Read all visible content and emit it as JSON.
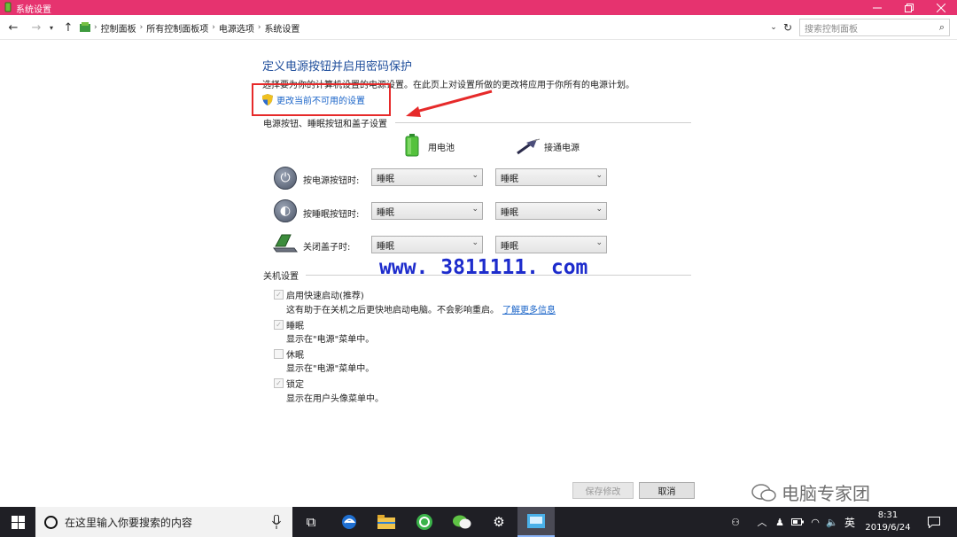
{
  "window": {
    "title": "系统设置",
    "controls": [
      "minimize",
      "maximize",
      "close"
    ]
  },
  "address": {
    "breadcrumbs": [
      "控制面板",
      "所有控制面板项",
      "电源选项",
      "系统设置"
    ],
    "search_placeholder": "搜索控制面板"
  },
  "page": {
    "heading": "定义电源按钮并启用密码保护",
    "description": "选择要为你的计算机设置的电源设置。在此页上对设置所做的更改将应用于你所有的电源计划。",
    "change_link": "更改当前不可用的设置",
    "power_section_title": "电源按钮、睡眠按钮和盖子设置",
    "columns": {
      "battery": "用电池",
      "plugged": "接通电源"
    },
    "rows": [
      {
        "label": "按电源按钮时:",
        "battery": "睡眠",
        "plugged": "睡眠",
        "icon": "power-icon"
      },
      {
        "label": "按睡眠按钮时:",
        "battery": "睡眠",
        "plugged": "睡眠",
        "icon": "sleep-icon"
      },
      {
        "label": "关闭盖子时:",
        "battery": "睡眠",
        "plugged": "睡眠",
        "icon": "laptop-lid-icon"
      }
    ],
    "shutdown_section_title": "关机设置",
    "shutdown_options": [
      {
        "label": "启用快速启动(推荐)",
        "desc": "这有助于在关机之后更快地启动电脑。不会影响重启。",
        "link": "了解更多信息",
        "checked": true
      },
      {
        "label": "睡眠",
        "desc": "显示在\"电源\"菜单中。",
        "checked": true
      },
      {
        "label": "休眠",
        "desc": "显示在\"电源\"菜单中。",
        "checked": false
      },
      {
        "label": "锁定",
        "desc": "显示在用户头像菜单中。",
        "checked": true
      }
    ],
    "watermark": "www. 3811111. com",
    "save_button": "保存修改",
    "cancel_button": "取消"
  },
  "overlay_brand": "电脑专家团",
  "taskbar": {
    "search_placeholder": "在这里输入你要搜索的内容",
    "input_indicator": "英",
    "time": "8:31",
    "date": "2019/6/24"
  },
  "colors": {
    "titlebar": "#e6336f",
    "heading": "#1e4d9b",
    "link": "#1a64c8",
    "annotation": "#e62a2a",
    "watermark": "#1d2ccc",
    "taskbar": "#1f1f25"
  }
}
